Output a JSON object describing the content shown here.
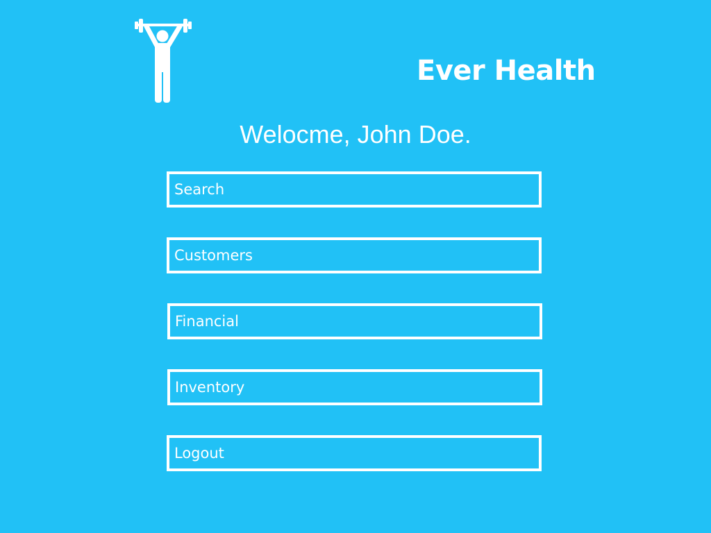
{
  "app": {
    "title": "Ever Health",
    "logo_icon": "weightlifter-icon"
  },
  "welcome": {
    "greeting": "Welocme,",
    "user_name": "John Doe."
  },
  "menu": {
    "items": [
      {
        "label": "Search"
      },
      {
        "label": "Customers"
      },
      {
        "label": "Financial"
      },
      {
        "label": "Inventory"
      },
      {
        "label": "Logout"
      }
    ]
  },
  "colors": {
    "background": "#21c1f6",
    "foreground": "#ffffff"
  }
}
